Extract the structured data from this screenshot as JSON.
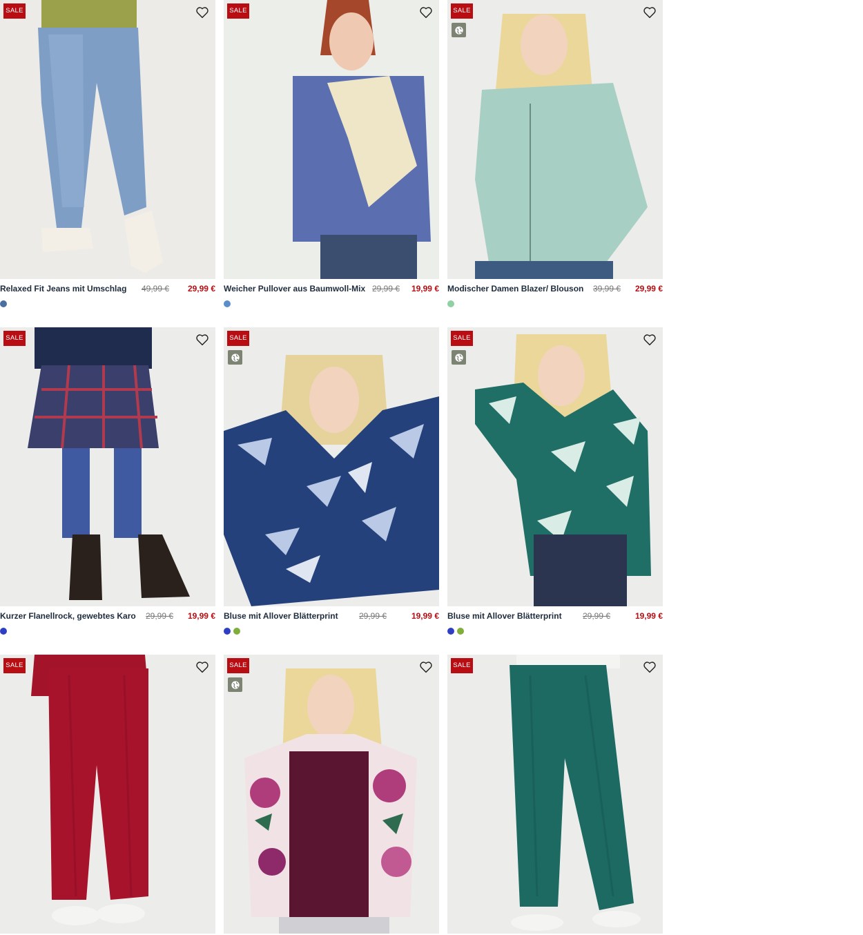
{
  "colors": {
    "sale_badge": "#b80d12",
    "price_new": "#b80d12",
    "eco_badge": "#7d8474"
  },
  "products": [
    {
      "name": "Relaxed Fit Jeans mit Umschlag",
      "old_price": "49,99 €",
      "new_price": "29,99 €",
      "badge": "SALE",
      "eco": false,
      "swatches": [
        "#4a6fa0"
      ]
    },
    {
      "name": "Weicher Pullover aus Baumwoll-Mix",
      "old_price": "29,99 €",
      "new_price": "19,99 €",
      "badge": "SALE",
      "eco": false,
      "swatches": [
        "#5b8ec9"
      ]
    },
    {
      "name": "Modischer Damen Blazer/ Blouson",
      "old_price": "39,99 €",
      "new_price": "29,99 €",
      "badge": "SALE",
      "eco": true,
      "swatches": [
        "#8fd0a4"
      ]
    },
    {
      "name": "Kurzer Flanellrock, gewebtes Karo",
      "old_price": "29,99 €",
      "new_price": "19,99 €",
      "badge": "SALE",
      "eco": false,
      "swatches": [
        "#2f3fc4"
      ]
    },
    {
      "name": "Bluse mit Allover Blätterprint",
      "old_price": "29,99 €",
      "new_price": "19,99 €",
      "badge": "SALE",
      "eco": true,
      "swatches": [
        "#2f3fc4",
        "#7fae3a"
      ]
    },
    {
      "name": "Bluse mit Allover Blätterprint",
      "old_price": "29,99 €",
      "new_price": "19,99 €",
      "badge": "SALE",
      "eco": true,
      "swatches": [
        "#2f3fc4",
        "#7fae3a"
      ]
    },
    {
      "name": "",
      "old_price": "",
      "new_price": "",
      "badge": "SALE",
      "eco": false,
      "swatches": []
    },
    {
      "name": "",
      "old_price": "",
      "new_price": "",
      "badge": "SALE",
      "eco": true,
      "swatches": []
    },
    {
      "name": "",
      "old_price": "",
      "new_price": "",
      "badge": "SALE",
      "eco": false,
      "swatches": []
    }
  ],
  "icons": {
    "wishlist": "heart-outline-icon",
    "eco": "globe-icon"
  }
}
